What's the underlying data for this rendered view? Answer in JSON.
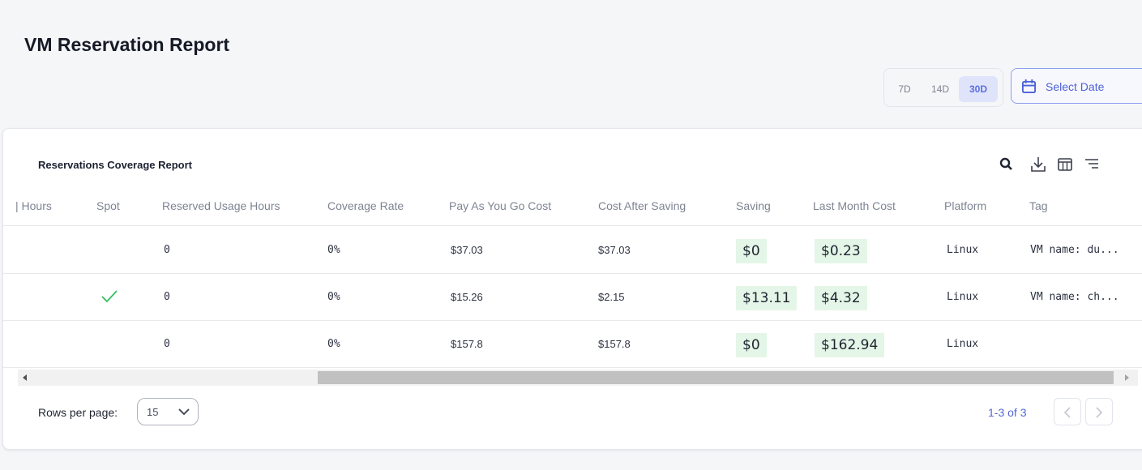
{
  "header": {
    "title": "VM Reservation Report",
    "ranges": [
      {
        "label": "7D",
        "active": false
      },
      {
        "label": "14D",
        "active": false
      },
      {
        "label": "30D",
        "active": true
      }
    ],
    "select_date": "Select Date"
  },
  "report": {
    "title": "Reservations Coverage Report",
    "toolbar": [
      "search-icon",
      "download-icon",
      "columns-icon",
      "filter-icon"
    ],
    "columns": [
      "| Hours",
      "Spot",
      "Reserved Usage Hours",
      "Coverage Rate",
      "Pay As You Go Cost",
      "Cost After Saving",
      "Saving",
      "Last Month Cost",
      "Platform",
      "Tag"
    ],
    "rows": [
      {
        "spot": false,
        "reserved_usage_hours": "0",
        "coverage_rate": "0%",
        "pay_as_you_go_cost": "$37.03",
        "cost_after_saving": "$37.03",
        "saving": "$0",
        "last_month_cost": "$0.23",
        "platform": "Linux",
        "tag": "VM name: du..."
      },
      {
        "spot": true,
        "reserved_usage_hours": "0",
        "coverage_rate": "0%",
        "pay_as_you_go_cost": "$15.26",
        "cost_after_saving": "$2.15",
        "saving": "$13.11",
        "last_month_cost": "$4.32",
        "platform": "Linux",
        "tag": "VM name: ch..."
      },
      {
        "spot": false,
        "reserved_usage_hours": "0",
        "coverage_rate": "0%",
        "pay_as_you_go_cost": "$157.8",
        "cost_after_saving": "$157.8",
        "saving": "$0",
        "last_month_cost": "$162.94",
        "platform": "Linux",
        "tag": ""
      }
    ],
    "colors": {
      "accent": "#5467d6",
      "highlight": "#e4f6e7",
      "check": "#2fbf5d"
    }
  },
  "footer": {
    "rows_per_page_label": "Rows per page:",
    "rows_per_page_value": "15",
    "range_text": "1-3 of 3"
  }
}
